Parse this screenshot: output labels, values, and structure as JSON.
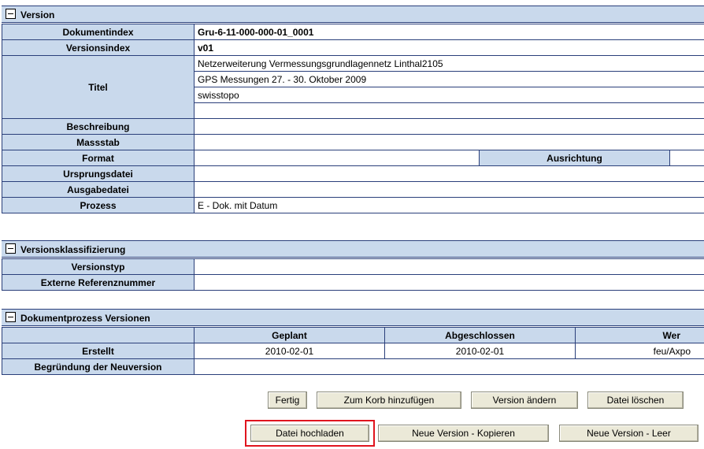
{
  "version": {
    "title": "Version",
    "rows": {
      "dokumentindex": {
        "label": "Dokumentindex",
        "value": "Gru-6-11-000-000-01_0001"
      },
      "versionsindex": {
        "label": "Versionsindex",
        "value": "v01"
      },
      "titel": {
        "label": "Titel",
        "values": [
          "Netzerweiterung Vermessungsgrundlagennetz Linthal2105",
          "GPS Messungen 27. - 30. Oktober 2009",
          "swisstopo",
          ""
        ]
      },
      "beschreibung": {
        "label": "Beschreibung",
        "value": ""
      },
      "massstab": {
        "label": "Massstab",
        "value": ""
      },
      "format": {
        "label": "Format",
        "value": "",
        "ausrichtung_label": "Ausrichtung",
        "ausrichtung_value": ""
      },
      "ursprungsdatei": {
        "label": "Ursprungsdatei",
        "value": ""
      },
      "ausgabedatei": {
        "label": "Ausgabedatei",
        "value": ""
      },
      "prozess": {
        "label": "Prozess",
        "value": "E - Dok. mit Datum"
      }
    }
  },
  "klassifizierung": {
    "title": "Versionsklassifizierung",
    "rows": {
      "versionstyp": {
        "label": "Versionstyp",
        "value": ""
      },
      "externe": {
        "label": "Externe Referenznummer",
        "value": ""
      }
    }
  },
  "prozess_versionen": {
    "title": "Dokumentprozess Versionen",
    "headers": {
      "geplant": "Geplant",
      "abgeschlossen": "Abgeschlossen",
      "wer": "Wer"
    },
    "erstellt": {
      "label": "Erstellt",
      "geplant": "2010-02-01",
      "abgeschlossen": "2010-02-01",
      "wer": "feu/Axpo"
    },
    "begruendung": {
      "label": "Begründung der Neuversion",
      "value": ""
    }
  },
  "buttons": {
    "fertig": "Fertig",
    "zum_korb": "Zum Korb hinzufügen",
    "version_aendern": "Version ändern",
    "datei_loeschen": "Datei löschen",
    "datei_hochladen": "Datei hochladen",
    "neue_kopieren": "Neue Version - Kopieren",
    "neue_leer": "Neue Version - Leer"
  },
  "colors": {
    "label_bg": "#c9d9ec",
    "border": "#2a3f7a",
    "button_bg": "#ebe9d8",
    "highlight": "#e0141e"
  }
}
